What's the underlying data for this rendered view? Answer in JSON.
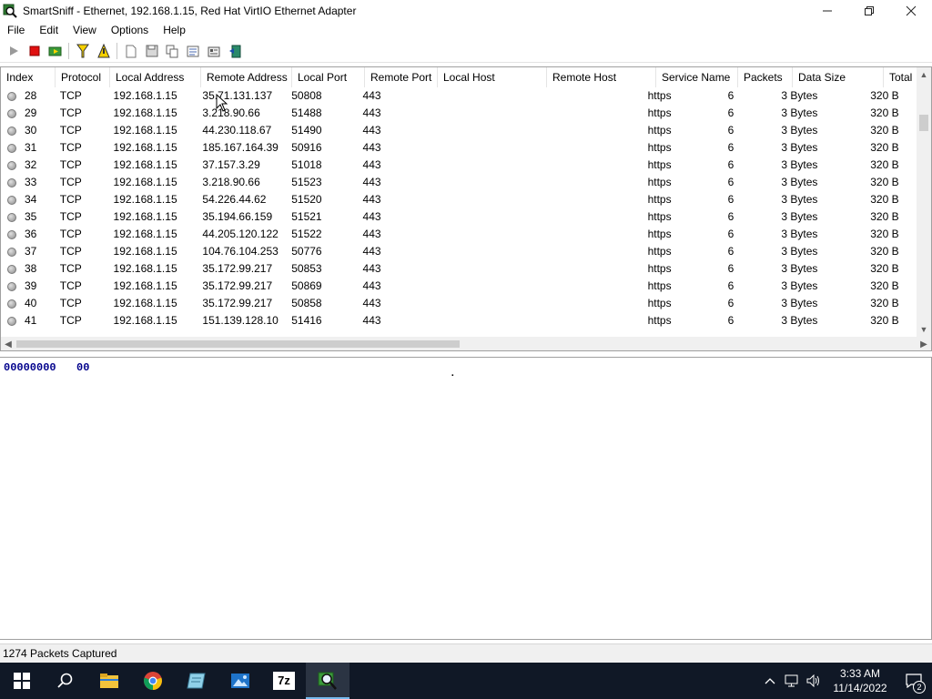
{
  "window": {
    "title": "SmartSniff  -  Ethernet, 192.168.1.15, Red Hat VirtIO Ethernet Adapter"
  },
  "menu": [
    "File",
    "Edit",
    "View",
    "Options",
    "Help"
  ],
  "toolbar": {
    "icons": [
      "play-icon",
      "stop-icon",
      "capture-options-icon",
      "filter-icon",
      "display-filter-icon",
      "new-icon",
      "save-icon",
      "copy-icon",
      "select-all-icon",
      "properties-icon",
      "exit-icon"
    ]
  },
  "table": {
    "columns": [
      "Index",
      "Protocol",
      "Local Address",
      "Remote Address",
      "Local Port",
      "Remote Port",
      "Local Host",
      "Remote Host",
      "Service Name",
      "Packets",
      "Data Size",
      "Total"
    ],
    "rows": [
      [
        "28",
        "TCP",
        "192.168.1.15",
        "35.71.131.137",
        "50808",
        "443",
        "",
        "",
        "https",
        "6",
        "3 Bytes",
        "320 B"
      ],
      [
        "29",
        "TCP",
        "192.168.1.15",
        "3.218.90.66",
        "51488",
        "443",
        "",
        "",
        "https",
        "6",
        "3 Bytes",
        "320 B"
      ],
      [
        "30",
        "TCP",
        "192.168.1.15",
        "44.230.118.67",
        "51490",
        "443",
        "",
        "",
        "https",
        "6",
        "3 Bytes",
        "320 B"
      ],
      [
        "31",
        "TCP",
        "192.168.1.15",
        "185.167.164.39",
        "50916",
        "443",
        "",
        "",
        "https",
        "6",
        "3 Bytes",
        "320 B"
      ],
      [
        "32",
        "TCP",
        "192.168.1.15",
        "37.157.3.29",
        "51018",
        "443",
        "",
        "",
        "https",
        "6",
        "3 Bytes",
        "320 B"
      ],
      [
        "33",
        "TCP",
        "192.168.1.15",
        "3.218.90.66",
        "51523",
        "443",
        "",
        "",
        "https",
        "6",
        "3 Bytes",
        "320 B"
      ],
      [
        "34",
        "TCP",
        "192.168.1.15",
        "54.226.44.62",
        "51520",
        "443",
        "",
        "",
        "https",
        "6",
        "3 Bytes",
        "320 B"
      ],
      [
        "35",
        "TCP",
        "192.168.1.15",
        "35.194.66.159",
        "51521",
        "443",
        "",
        "",
        "https",
        "6",
        "3 Bytes",
        "320 B"
      ],
      [
        "36",
        "TCP",
        "192.168.1.15",
        "44.205.120.122",
        "51522",
        "443",
        "",
        "",
        "https",
        "6",
        "3 Bytes",
        "320 B"
      ],
      [
        "37",
        "TCP",
        "192.168.1.15",
        "104.76.104.253",
        "50776",
        "443",
        "",
        "",
        "https",
        "6",
        "3 Bytes",
        "320 B"
      ],
      [
        "38",
        "TCP",
        "192.168.1.15",
        "35.172.99.217",
        "50853",
        "443",
        "",
        "",
        "https",
        "6",
        "3 Bytes",
        "320 B"
      ],
      [
        "39",
        "TCP",
        "192.168.1.15",
        "35.172.99.217",
        "50869",
        "443",
        "",
        "",
        "https",
        "6",
        "3 Bytes",
        "320 B"
      ],
      [
        "40",
        "TCP",
        "192.168.1.15",
        "35.172.99.217",
        "50858",
        "443",
        "",
        "",
        "https",
        "6",
        "3 Bytes",
        "320 B"
      ],
      [
        "41",
        "TCP",
        "192.168.1.15",
        "151.139.128.10",
        "51416",
        "443",
        "",
        "",
        "https",
        "6",
        "3 Bytes",
        "320 B"
      ]
    ]
  },
  "hex": {
    "offset": "00000000",
    "bytes": "00",
    "ascii": "."
  },
  "status": {
    "text": "1274 Packets Captured"
  },
  "taskbar": {
    "apps": [
      "start-icon",
      "search-icon",
      "file-explorer-icon",
      "chrome-icon",
      "notepad-icon",
      "photos-icon",
      "7zip-icon",
      "smartsniff-icon"
    ],
    "sevenzip_label": "7z",
    "time": "3:33 AM",
    "date": "11/14/2022",
    "notifications": "2"
  }
}
